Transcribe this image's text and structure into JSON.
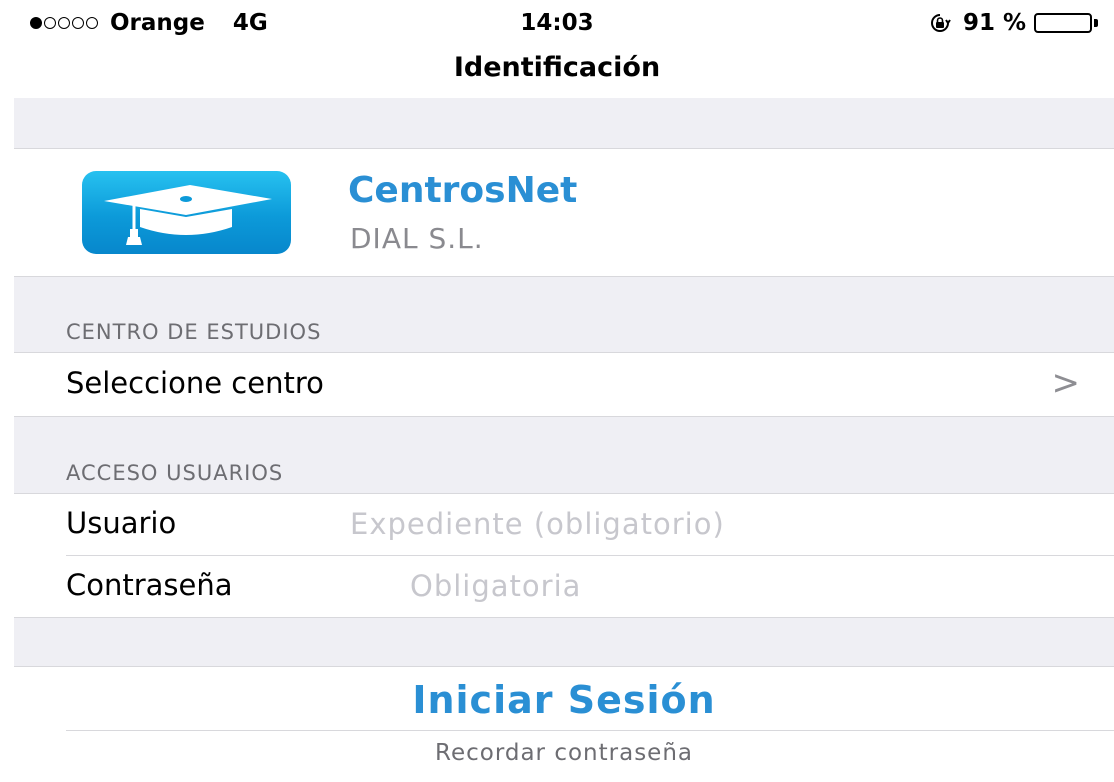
{
  "status_bar": {
    "signal_bars_filled": 1,
    "signal_bars_total": 5,
    "carrier": "Orange",
    "network": "4G",
    "time": "14:03",
    "battery_text": "91 %",
    "battery_level": 0.91
  },
  "nav": {
    "title": "Identificación"
  },
  "app": {
    "name": "CentrosNet",
    "company": "DIAL S.L.",
    "icon": "graduation-cap-icon"
  },
  "centro": {
    "section_title": "CENTRO DE ESTUDIOS",
    "select_label": "Seleccione centro",
    "chevron": ">"
  },
  "access": {
    "section_title": "ACCESO USUARIOS",
    "user_label": "Usuario",
    "user_placeholder": "Expediente (obligatorio)",
    "user_value": "",
    "password_label": "Contraseña",
    "password_placeholder": "Obligatoria",
    "password_value": ""
  },
  "actions": {
    "login_label": "Iniciar Sesión",
    "remember_label": "Recordar contraseña"
  },
  "colors": {
    "accent": "#2a8fd4",
    "group_background": "#efeff4",
    "secondary_text": "#6d6d72",
    "placeholder": "#c7c7cd"
  }
}
